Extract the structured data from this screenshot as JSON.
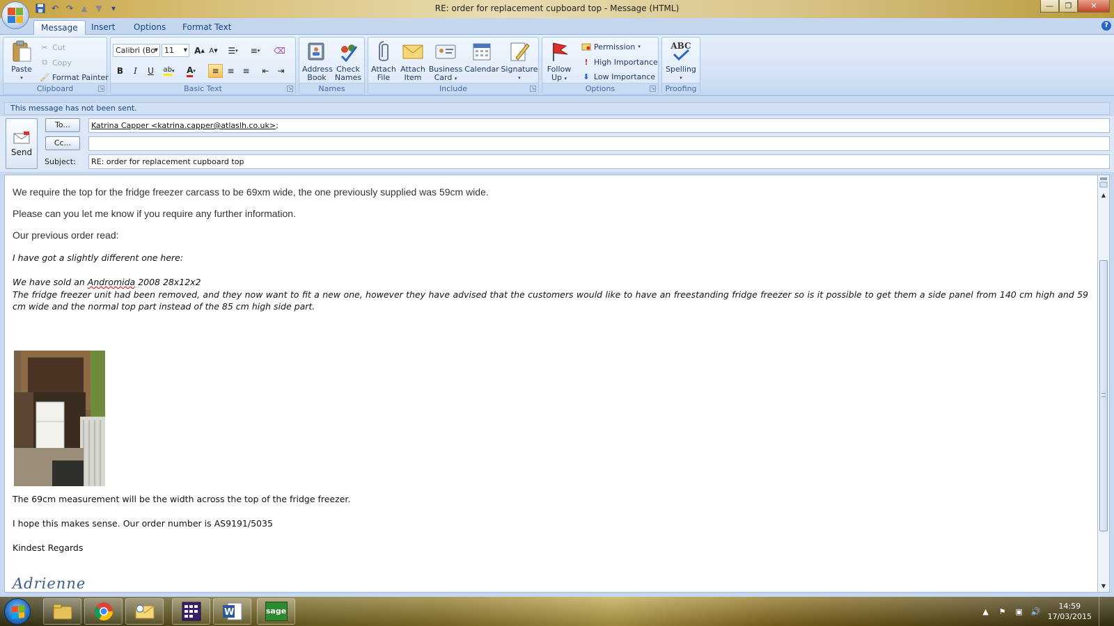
{
  "window": {
    "title": "RE: order for replacement cupboard top - Message (HTML)",
    "controls": {
      "minimize": "—",
      "maximize": "❐",
      "close": "✕"
    }
  },
  "tabs": [
    {
      "label": "Message",
      "active": true
    },
    {
      "label": "Insert"
    },
    {
      "label": "Options"
    },
    {
      "label": "Format Text"
    }
  ],
  "ribbon": {
    "clipboard": {
      "label": "Clipboard",
      "paste": "Paste",
      "cut": "Cut",
      "copy": "Copy",
      "format_painter": "Format Painter"
    },
    "basic_text": {
      "label": "Basic Text",
      "font": "Calibri (Bo",
      "size": "11",
      "bold": "B",
      "italic": "I",
      "underline": "U"
    },
    "names": {
      "label": "Names",
      "address_book": [
        "Address",
        "Book"
      ],
      "check_names": [
        "Check",
        "Names"
      ]
    },
    "include": {
      "label": "Include",
      "attach_file": [
        "Attach",
        "File"
      ],
      "attach_item": [
        "Attach",
        "Item"
      ],
      "business_card": [
        "Business",
        "Card"
      ],
      "calendar": "Calendar",
      "signature": "Signature"
    },
    "options": {
      "label": "Options",
      "follow_up": [
        "Follow",
        "Up"
      ],
      "permission": "Permission",
      "high_importance": "High Importance",
      "low_importance": "Low Importance"
    },
    "proofing": {
      "label": "Proofing",
      "spelling": "Spelling",
      "spelling_icon_text": "ABC"
    }
  },
  "infobar": "This message has not been sent.",
  "header": {
    "send_label": "Send",
    "to_button": "To...",
    "cc_button": "Cc...",
    "subject_label": "Subject:",
    "to_value": "Katrina Capper <katrina.capper@atlaslh.co.uk>",
    "to_suffix": ";",
    "cc_value": "",
    "subject_value": "RE: order for replacement cupboard top"
  },
  "body": {
    "p1": "We require the top for the fridge freezer carcass to be 69xm wide, the one previously supplied was 59cm wide.",
    "p2": "Please can you let me know if you require any further information.",
    "p3": "Our previous order read:",
    "q1": "I have got a slightly different one here:",
    "q2_pre": "We have sold an ",
    "q2_word": "Andromida",
    "q2_post": " 2008 28x12x2",
    "q3": "The fridge freezer unit had been removed, and they now want to fit a new one, however they have advised that  the customers would like to have an freestanding fridge freezer so is it possible to get them  a  side panel from 140 cm high and 59 cm wide and the normal top part  instead of the 85 cm high side part.",
    "p4": "The 69cm measurement will be the width across the top of the fridge freezer.",
    "p5": "I hope this makes sense.  Our order number is AS9191/5035",
    "p6": "Kindest Regards",
    "signature": "Adrienne"
  },
  "taskbar": {
    "time": "14:59",
    "date": "17/03/2015",
    "apps": [
      "explorer-icon",
      "chrome-icon",
      "outlook-icon",
      "calendar-app-icon",
      "word-icon",
      "sage-icon"
    ],
    "sage_label": "sage"
  },
  "colors": {
    "ribbon_text": "#15428b",
    "accent_blue": "#2a66c4",
    "signature": "#3b5e8c"
  }
}
